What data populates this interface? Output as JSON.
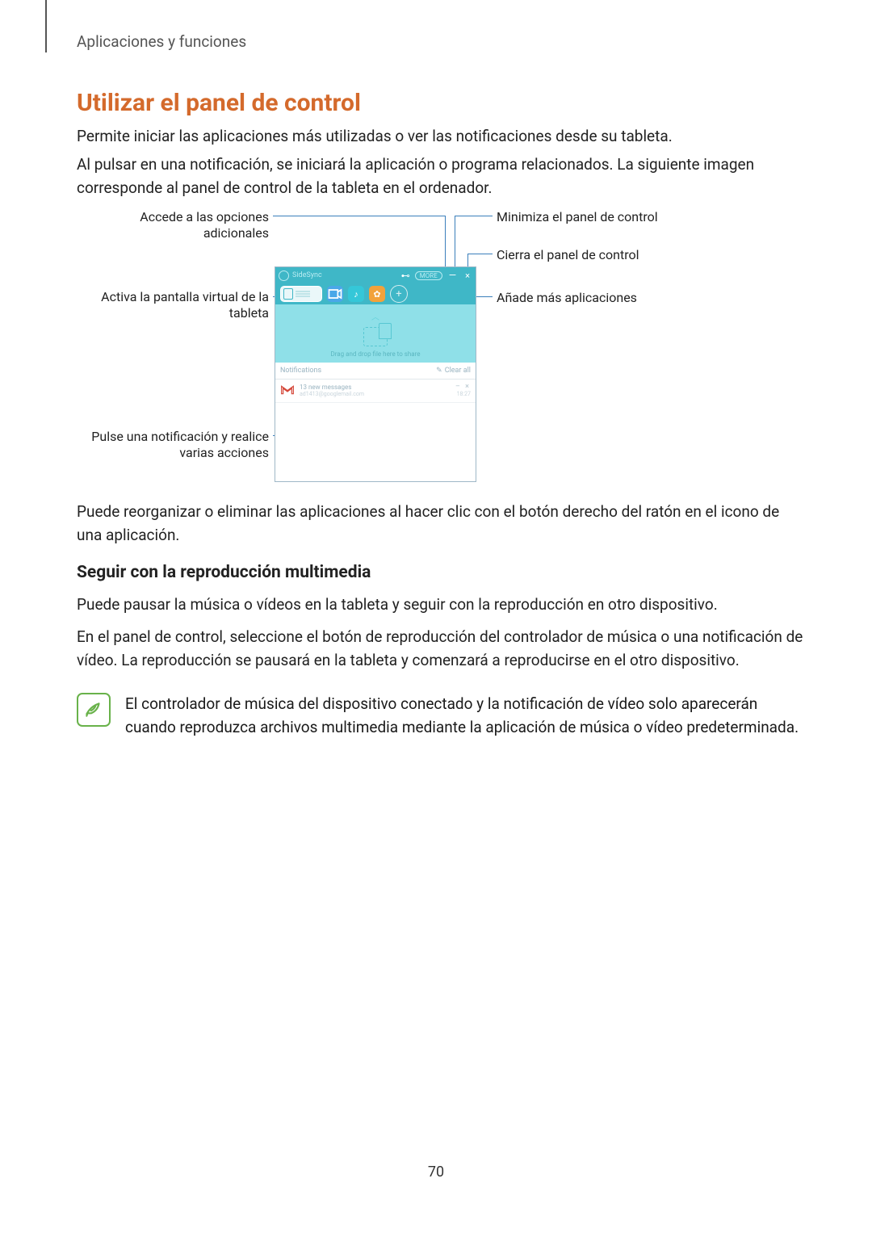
{
  "header": "Aplicaciones y funciones",
  "h1": "Utilizar el panel de control",
  "p1": "Permite iniciar las aplicaciones más utilizadas o ver las notificaciones desde su tableta.",
  "p2": "Al pulsar en una notificación, se iniciará la aplicación o programa relacionados. La siguiente imagen corresponde al panel de control de la tableta en el ordenador.",
  "p3": "Puede reorganizar o eliminar las aplicaciones al hacer clic con el botón derecho del ratón en el icono de una aplicación.",
  "h2": "Seguir con la reproducción multimedia",
  "p4": "Puede pausar la música o vídeos en la tableta y seguir con la reproducción en otro dispositivo.",
  "p5": "En el panel de control, seleccione el botón de reproducción del controlador de música o una notificación de vídeo. La reproducción se pausará en la tableta y comenzará a reproducirse en el otro dispositivo.",
  "note": "El controlador de música del dispositivo conectado y la notificación de vídeo solo aparecerán cuando reproduzca archivos multimedia mediante la aplicación de música o vídeo predeterminada.",
  "callouts": {
    "options": "Accede a las opciones adicionales",
    "mirror": "Activa la pantalla virtual de la tableta",
    "notif": "Pulse una notificación y realice varias acciones",
    "minimize": "Minimiza el panel de control",
    "close": "Cierra el panel de control",
    "addapps": "Añade más aplicaciones"
  },
  "app": {
    "title": "SideSync",
    "more": "MORE",
    "min": "—",
    "close": "×",
    "share": "Drag and drop file here to share",
    "notif_label": "Notifications",
    "clear_all": "Clear all",
    "msg_title": "13 new messages",
    "msg_sub": "ad1413@googlemail.com",
    "msg_time": "18:27",
    "msg_ctrl": "–  ×"
  },
  "page": "70"
}
